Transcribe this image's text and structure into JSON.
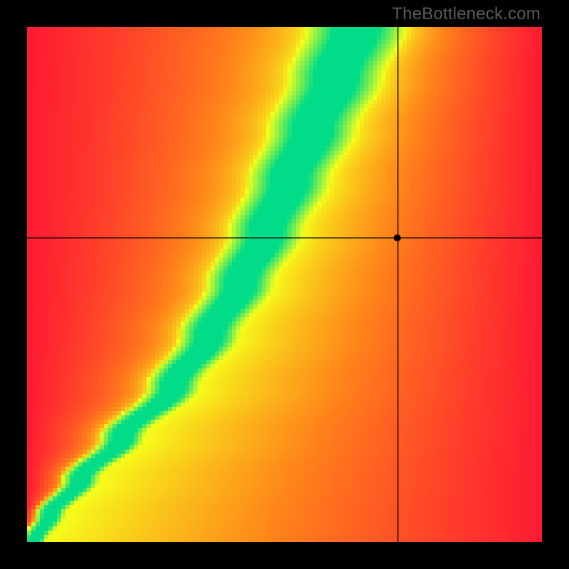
{
  "watermark": "TheBottleneck.com",
  "chart_data": {
    "type": "heatmap",
    "title": "",
    "xlabel": "",
    "ylabel": "",
    "xlim": [
      0,
      100
    ],
    "ylim": [
      0,
      100
    ],
    "crosshair": {
      "x": 72,
      "y": 59
    },
    "marker": {
      "x": 72,
      "y": 59
    },
    "ridge_curve_description": "Green optimum ridge: starts near (2,2) at lower-left, bows slightly right to roughly (42,48), then curves upward through about (55,75) and exits top edge near x≈64. Values on the ridge ≈ 0 (best match).",
    "field_description": "Signed mismatch field over a 100×100 grid. Ridge = 0 (green). Left/above ridge trends to strongly positive (red, GPU-bound). Right/below ridge trends to strongly negative (red, CPU-bound). Near-ridge band is yellow.",
    "color_scale": {
      "neg_extreme": "#ff1a33",
      "neg_mid": "#ff7a1a",
      "near_zero_warm": "#ffd21a",
      "near_zero": "#f6ff1a",
      "optimum": "#00e08a",
      "pos_mid": "#ff7a1a",
      "pos_extreme": "#ff1a33"
    },
    "grid": "off",
    "legend": "none"
  }
}
